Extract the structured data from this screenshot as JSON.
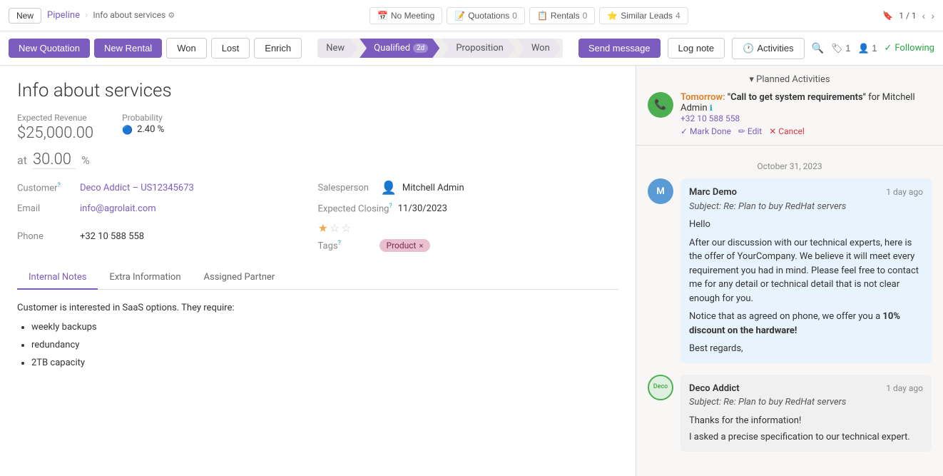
{
  "topbar": {
    "new_label": "New",
    "breadcrumb": "Pipeline",
    "subbreadcrumb": "Info about services",
    "no_meeting_label": "No Meeting",
    "quotations_label": "Quotations",
    "quotations_count": "0",
    "rentals_label": "Rentals",
    "rentals_count": "0",
    "similar_leads_label": "Similar Leads",
    "similar_leads_count": "4",
    "pagination": "1 / 1"
  },
  "actionbar": {
    "new_quotation": "New Quotation",
    "new_rental": "New Rental",
    "won": "Won",
    "lost": "Lost",
    "enrich": "Enrich",
    "send_message": "Send message",
    "log_note": "Log note",
    "activities": "Activities",
    "following": "Following",
    "stages": [
      {
        "label": "New"
      },
      {
        "label": "Qualified",
        "badge": "2d",
        "active": true
      },
      {
        "label": "Proposition"
      },
      {
        "label": "Won"
      }
    ]
  },
  "record": {
    "title": "Info about services",
    "expected_revenue_label": "Expected Revenue",
    "probability_label": "Probability",
    "probability_value": "2.40 %",
    "revenue_value": "$25,000.00",
    "at_label": "at",
    "at_value": "30.00",
    "percent_label": "%",
    "customer_label": "Customer",
    "customer_tooltip": "?",
    "customer_value": "Deco Addict – US12345673",
    "email_label": "Email",
    "email_value": "info@agrolait.com",
    "phone_label": "Phone",
    "phone_value": "+32 10 588 558",
    "salesperson_label": "Salesperson",
    "salesperson_value": "Mitchell Admin",
    "expected_closing_label": "Expected Closing",
    "expected_closing_tooltip": "?",
    "expected_closing_value": "11/30/2023",
    "tags_label": "Tags",
    "tags_tooltip": "?",
    "tag_value": "Product",
    "stars": [
      true,
      false,
      false
    ],
    "tabs": [
      "Internal Notes",
      "Extra Information",
      "Assigned Partner"
    ],
    "active_tab": "Internal Notes",
    "notes_intro": "Customer is interested in SaaS options. They require:",
    "notes_items": [
      "weekly backups",
      "redundancy",
      "2TB capacity"
    ]
  },
  "right_panel": {
    "planned_activities_header": "Planned Activities",
    "activity": {
      "time": "Tomorrow:",
      "title": "\"Call to get system requirements\"",
      "for_label": "for Mitchell",
      "admin_label": "Admin",
      "phone": "+32 10 588 558",
      "mark_done": "✓ Mark Done",
      "edit": "✏ Edit",
      "cancel": "✕ Cancel"
    },
    "date_divider": "October 31, 2023",
    "messages": [
      {
        "sender": "Marc Demo",
        "time": "1 day ago",
        "subject": "Subject: Re: Plan to buy RedHat servers",
        "lines": [
          "Hello",
          "After our discussion with our technical experts, here is the offer of YourCompany. We believe it will meet every requirement you had in mind. Please feel free to contact me for any detail or technical detail that is not clear enough for you.",
          "Notice that as agreed on phone, we offer you a 10% discount on the hardware!",
          "Best regards,"
        ],
        "bold_phrase": "10% discount on the hardware!",
        "avatar_initials": "M",
        "avatar_color": "#5b9bd5"
      },
      {
        "sender": "Deco Addict",
        "time": "1 day ago",
        "subject": "Subject: Re: Plan to buy RedHat servers",
        "lines": [
          "Thanks for the information!",
          "I asked a precise specification to our technical expert."
        ],
        "avatar_initials": "Deco",
        "avatar_color": "#e0f0e0",
        "is_deco": true
      }
    ]
  }
}
